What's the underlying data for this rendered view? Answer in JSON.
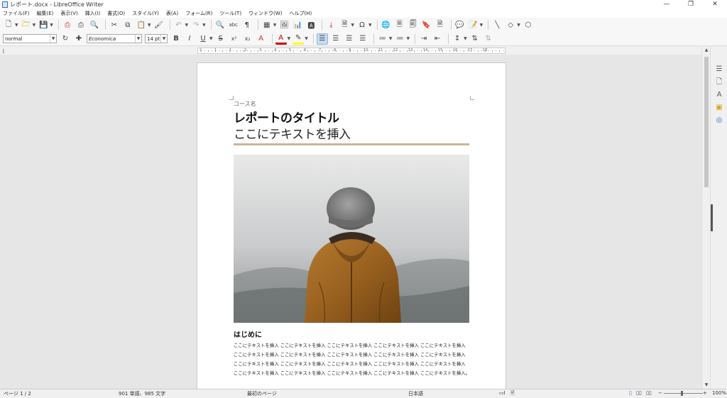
{
  "window": {
    "title": "レポート.docx - LibreOffice Writer",
    "controls": [
      "—",
      "❐",
      "✕"
    ]
  },
  "menu": [
    "ファイル(F)",
    "編集(E)",
    "表示(V)",
    "挿入(I)",
    "書式(O)",
    "スタイル(Y)",
    "表(A)",
    "フォーム(R)",
    "ツール(T)",
    "ウィンドウ(W)",
    "ヘルプ(H)"
  ],
  "format_bar": {
    "paragraph_style": "normal",
    "font_name": "Economica",
    "font_size": "14 pt"
  },
  "document": {
    "course_name": "コース名",
    "title": "レポートのタイトル",
    "subtitle": "ここにテキストを挿入",
    "heading": "はじめに",
    "body": "ここにテキストを挿入 ここにテキストを挿入 ここにテキストを挿入 ここにテキストを挿入 ここにテキストを挿入 ここにテキストを挿入 ここにテキストを挿入 ここにテキストを挿入 ここにテキストを挿入 ここにテキストを挿入 ここにテキストを挿入 ここにテキストを挿入 ここにテキストを挿入 ここにテキストを挿入 ここにテキストを挿入 ここにテキストを挿入 ここにテキストを挿入 ここにテキストを挿入 ここにテキストを挿入 ここにテキストを挿入。",
    "rule_color": "#cdb49a"
  },
  "ruler": {
    "labels": [
      "2",
      "1",
      "1",
      "2",
      "3",
      "4",
      "5",
      "6",
      "7",
      "8",
      "9",
      "10",
      "11",
      "12",
      "13",
      "14",
      "15",
      "16",
      "17",
      "18"
    ]
  },
  "status": {
    "page": "ページ 1 / 2",
    "words": "901 単語、985 文字",
    "page_style": "最初のページ",
    "language": "日本語",
    "zoom": "100%"
  },
  "colors": {
    "accent": "#2a6ebb",
    "active_button": "#c5dcf2"
  }
}
